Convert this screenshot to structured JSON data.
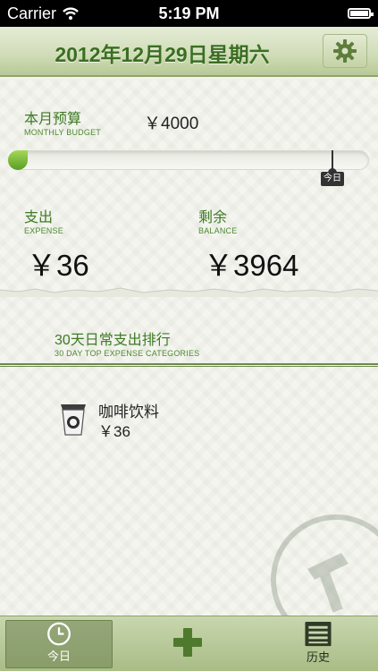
{
  "status_bar": {
    "carrier": "Carrier",
    "time": "5:19 PM"
  },
  "header": {
    "title": "2012年12月29日星期六",
    "settings_icon": "gear-icon"
  },
  "budget": {
    "label_cn": "本月预算",
    "label_en": "MONTHLY BUDGET",
    "value": "￥4000",
    "progress_fraction": 0.009,
    "today_marker": "今日"
  },
  "expense": {
    "label_cn": "支出",
    "label_en": "EXPENSE",
    "value": "￥36"
  },
  "balance": {
    "label_cn": "剩余",
    "label_en": "BALANCE",
    "value": "￥3964"
  },
  "ranking": {
    "title_cn": "30天日常支出排行",
    "title_en": "30 DAY TOP EXPENSE CATEGORIES"
  },
  "categories": [
    {
      "name": "咖啡饮料",
      "amount": "￥36",
      "icon": "coffee-cup-icon"
    }
  ],
  "tabs": [
    {
      "label": "今日",
      "icon": "clock-icon",
      "selected": true
    },
    {
      "label": "",
      "icon": "plus-icon"
    },
    {
      "label": "历史",
      "icon": "list-icon"
    }
  ],
  "colors": {
    "accent_green": "#3e7b24",
    "header_bg": "#cfdcb6",
    "progress_green": "#7bbd3c"
  }
}
